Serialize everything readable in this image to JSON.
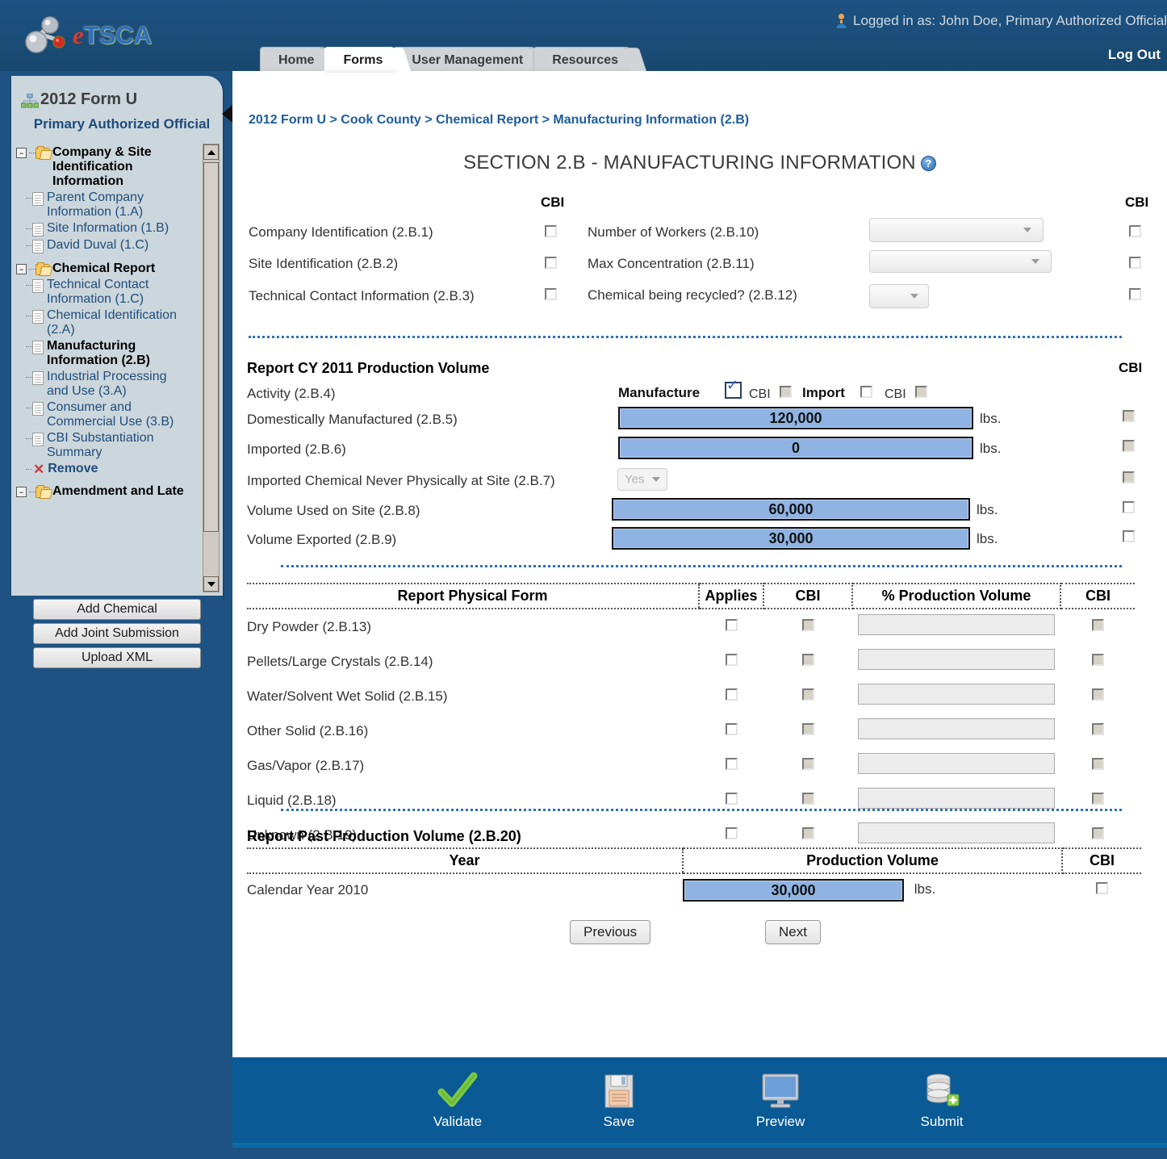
{
  "app": {
    "brand_e": "e",
    "brand_name": "TSCA",
    "login_text": "Logged in as: John Doe, Primary Authorized Official",
    "logout_label": "Log Out"
  },
  "tabs": [
    {
      "label": "Home",
      "active": false
    },
    {
      "label": "Forms",
      "active": true
    },
    {
      "label": "User Management",
      "active": false
    },
    {
      "label": "Resources",
      "active": false
    }
  ],
  "sidebar": {
    "title": "2012 Form U",
    "role": "Primary Authorized Official",
    "tree": [
      {
        "type": "group",
        "label": "Company & Site Identification Information",
        "expander": "–"
      },
      {
        "type": "leaf",
        "label": "Parent Company Information (1.A)"
      },
      {
        "type": "leaf",
        "label": "Site Information (1.B)"
      },
      {
        "type": "leaf",
        "label": "David Duval (1.C)"
      },
      {
        "type": "group",
        "label": "Chemical Report",
        "expander": "–"
      },
      {
        "type": "leaf",
        "label": "Technical Contact Information (1.C)"
      },
      {
        "type": "leaf",
        "label": "Chemical Identification (2.A)"
      },
      {
        "type": "leaf",
        "label": "Manufacturing Information (2.B)",
        "selected": true
      },
      {
        "type": "leaf",
        "label": "Industrial Processing and Use (3.A)"
      },
      {
        "type": "leaf",
        "label": "Consumer and Commercial Use (3.B)"
      },
      {
        "type": "leaf",
        "label": "CBI Substantiation Summary"
      },
      {
        "type": "remove",
        "label": "Remove"
      },
      {
        "type": "group",
        "label": "Amendment and Late",
        "expander": "–"
      }
    ],
    "buttons": [
      {
        "label": "Add Chemical"
      },
      {
        "label": "Add Joint Submission"
      },
      {
        "label": "Upload XML"
      }
    ]
  },
  "main": {
    "breadcrumb": "2012 Form U > Cook County > Chemical Report > Manufacturing Information (2.B)",
    "section_title": "SECTION 2.B - MANUFACTURING INFORMATION",
    "cbi_header": "CBI",
    "left_fields": [
      {
        "label": "Company Identification (2.B.1)",
        "cbi_checked": false,
        "cbi_disabled": false
      },
      {
        "label": "Site Identification (2.B.2)",
        "cbi_checked": false,
        "cbi_disabled": false
      },
      {
        "label": "Technical Contact Information (2.B.3)",
        "cbi_checked": false,
        "cbi_disabled": false
      }
    ],
    "right_fields": [
      {
        "label": "Number of Workers (2.B.10)",
        "value": "",
        "cbi_checked": false,
        "cbi_disabled": false
      },
      {
        "label": "Max Concentration (2.B.11)",
        "value": "",
        "cbi_checked": false,
        "cbi_disabled": false
      },
      {
        "label": "Chemical being recycled? (2.B.12)",
        "value": "",
        "cbi_checked": false,
        "cbi_disabled": false
      }
    ],
    "production": {
      "heading": "Report CY 2011 Production Volume",
      "cbi_header": "CBI",
      "activity_label": "Activity (2.B.4)",
      "activity": {
        "manufacture_label": "Manufacture",
        "manufacture_checked": true,
        "manufacture_cbi_label": "CBI",
        "manufacture_cbi_checked": false,
        "manufacture_cbi_disabled": true,
        "import_label": "Import",
        "import_checked": false,
        "import_cbi_label": "CBI",
        "import_cbi_checked": false,
        "import_cbi_disabled": true
      },
      "rows": [
        {
          "label": "Domestically Manufactured (2.B.5)",
          "value": "120,000",
          "unit": "lbs.",
          "cbi_checked": false,
          "cbi_disabled": true
        },
        {
          "label": "Imported (2.B.6)",
          "value": "0",
          "unit": "lbs.",
          "cbi_checked": false,
          "cbi_disabled": true
        },
        {
          "label": "Imported Chemical Never Physically at Site (2.B.7)",
          "dropdown_value": "Yes",
          "unit": "",
          "cbi_checked": false,
          "cbi_disabled": true
        },
        {
          "label": "Volume Used on Site (2.B.8)",
          "value": "60,000",
          "unit": "lbs.",
          "cbi_checked": false,
          "cbi_disabled": false
        },
        {
          "label": "Volume Exported (2.B.9)",
          "value": "30,000",
          "unit": "lbs.",
          "cbi_checked": false,
          "cbi_disabled": false
        }
      ]
    },
    "physical_form": {
      "headers": [
        "Report Physical Form",
        "Applies",
        "CBI",
        "% Production Volume",
        "CBI"
      ],
      "rows": [
        {
          "label": "Dry Powder (2.B.13)",
          "applies": false,
          "cbi1": false,
          "percent": "",
          "cbi2": false
        },
        {
          "label": "Pellets/Large Crystals (2.B.14)",
          "applies": false,
          "cbi1": false,
          "percent": "",
          "cbi2": false
        },
        {
          "label": "Water/Solvent Wet Solid (2.B.15)",
          "applies": false,
          "cbi1": false,
          "percent": "",
          "cbi2": false
        },
        {
          "label": "Other Solid (2.B.16)",
          "applies": false,
          "cbi1": false,
          "percent": "",
          "cbi2": false
        },
        {
          "label": "Gas/Vapor (2.B.17)",
          "applies": false,
          "cbi1": false,
          "percent": "",
          "cbi2": false
        },
        {
          "label": "Liquid (2.B.18)",
          "applies": false,
          "cbi1": false,
          "percent": "",
          "cbi2": false
        },
        {
          "label": "Unknown (2.B.19)",
          "applies": false,
          "cbi1": false,
          "percent": "",
          "cbi2": false
        }
      ]
    },
    "past_volume": {
      "heading": "Report Past Production Volume (2.B.20)",
      "headers": [
        "Year",
        "Production Volume",
        "CBI"
      ],
      "rows": [
        {
          "year": "Calendar Year 2010",
          "value": "30,000",
          "unit": "lbs.",
          "cbi_checked": false
        }
      ]
    },
    "nav": {
      "previous": "Previous",
      "next": "Next"
    }
  },
  "footer": {
    "actions": [
      {
        "label": "Validate",
        "icon": "check-icon"
      },
      {
        "label": "Save",
        "icon": "floppy-disk-icon"
      },
      {
        "label": "Preview",
        "icon": "monitor-icon"
      },
      {
        "label": "Submit",
        "icon": "database-add-icon"
      }
    ]
  }
}
